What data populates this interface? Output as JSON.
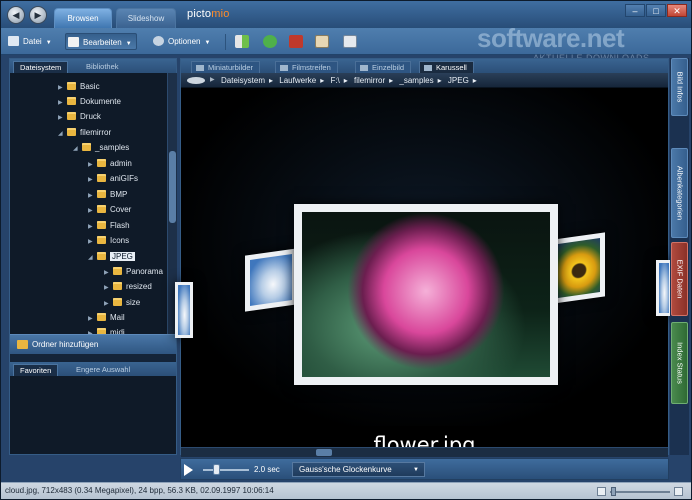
{
  "title_tabs": {
    "browse": "Browsen",
    "slideshow": "Slideshow"
  },
  "brand": {
    "name": "picto",
    "suffix": "mio"
  },
  "watermark": {
    "text": "software.net",
    "sub": "AKTUELLE DOWNLOADS"
  },
  "menu": {
    "file": "Datei",
    "edit": "Bearbeiten",
    "options": "Optionen"
  },
  "left_panel": {
    "tabs": [
      "Dateisystem",
      "Bibliothek"
    ],
    "tree": [
      {
        "label": "Basic"
      },
      {
        "label": "Dokumente"
      },
      {
        "label": "Druck"
      },
      {
        "label": "filemirror"
      },
      {
        "label": "_samples"
      },
      {
        "label": "admin"
      },
      {
        "label": "aniGIFs"
      },
      {
        "label": "BMP"
      },
      {
        "label": "Cover"
      },
      {
        "label": "Flash"
      },
      {
        "label": "Icons"
      },
      {
        "label": "JPEG"
      },
      {
        "label": "Panorama"
      },
      {
        "label": "resized"
      },
      {
        "label": "size"
      },
      {
        "label": "Mail"
      },
      {
        "label": "midi"
      }
    ],
    "add_folder": "Ordner hinzufügen",
    "fav_tabs": [
      "Favoriten",
      "Engere Auswahl"
    ]
  },
  "viewer": {
    "tabs": [
      "Miniaturbilder",
      "Filmstreifen",
      "Einzelbild",
      "Karussell"
    ],
    "breadcrumb": [
      "Dateisystem",
      "Laufwerke",
      "F:\\",
      "filemirror",
      "_samples",
      "JPEG"
    ],
    "current_file": "flower.jpg"
  },
  "playbar": {
    "speed": "2.0 sec",
    "transition": "Gauss'sche Glockenkurve"
  },
  "right_tabs": [
    "Bild Infos",
    "Albenkategorien",
    "EXIF Daten",
    "Index Status"
  ],
  "statusbar": {
    "text": "cloud.jpg, 712x483 (0.34 Megapixel), 24 bpp, 56.3 KB, 02.09.1997 10:06:14"
  },
  "colors": {
    "accent": "#3f76b0",
    "folder": "#e9b640",
    "brand_orange": "#ff8c2a"
  }
}
